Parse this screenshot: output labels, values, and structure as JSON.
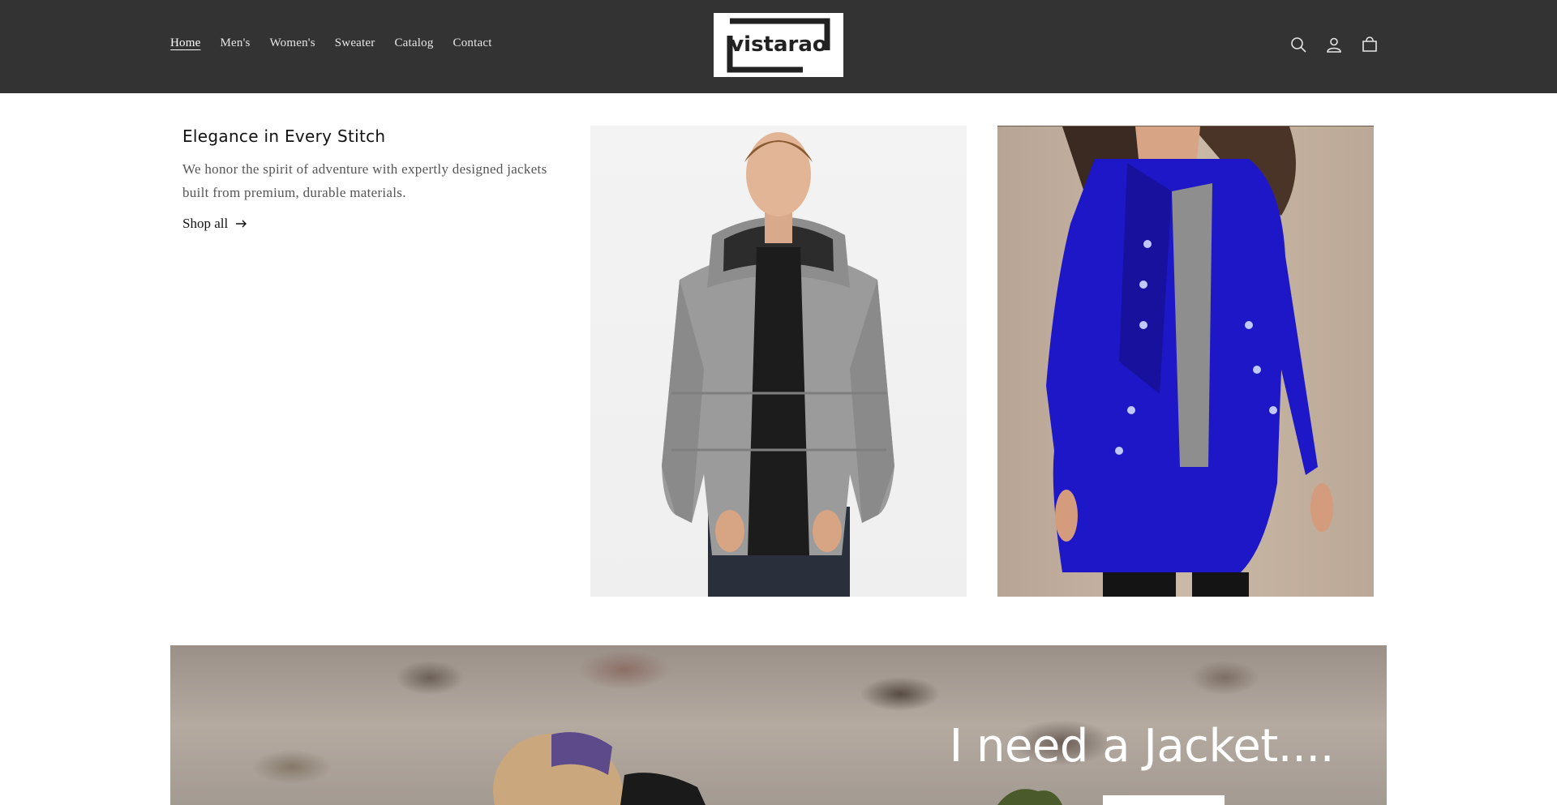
{
  "nav": {
    "items": [
      {
        "label": "Home",
        "active": true
      },
      {
        "label": "Men's"
      },
      {
        "label": "Women's"
      },
      {
        "label": "Sweater"
      },
      {
        "label": "Catalog"
      },
      {
        "label": "Contact"
      }
    ]
  },
  "logo": {
    "text": "vistarao"
  },
  "header_icons": [
    "search-icon",
    "account-icon",
    "cart-icon"
  ],
  "intro": {
    "title": "Elegance in Every Stitch",
    "description": "We honor the spirit of adventure with expertly designed jackets built from premium, durable materials.",
    "link_label": "Shop all"
  },
  "banner": {
    "title": "I need a Jacket...."
  },
  "colors": {
    "header_bg": "#333333",
    "coat_blue": "#1e17c8",
    "jacket_gray": "#9a9a9a"
  }
}
